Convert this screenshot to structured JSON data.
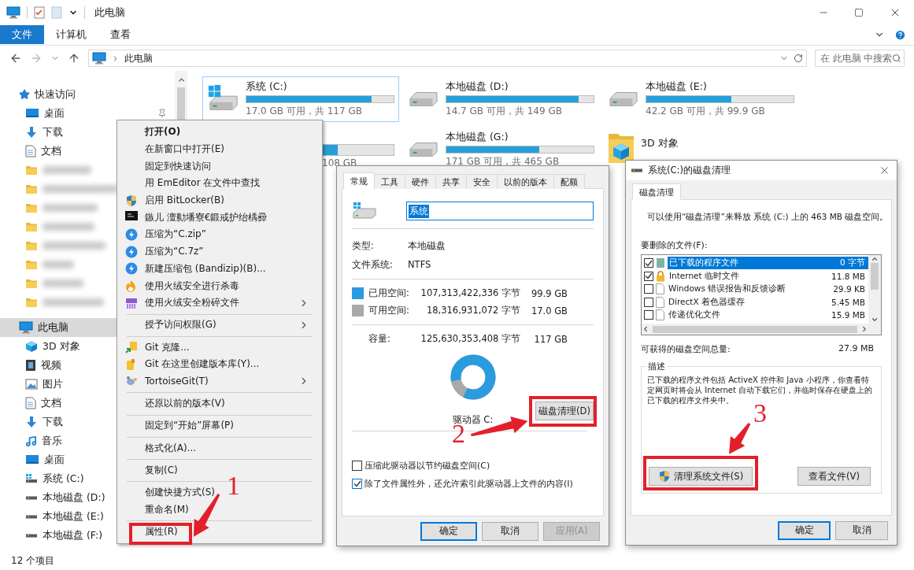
{
  "window": {
    "title": "此电脑"
  },
  "ribbon": {
    "tabs": [
      {
        "label": "文件",
        "selected": true
      },
      {
        "label": "计算机",
        "selected": false
      },
      {
        "label": "查看",
        "selected": false
      }
    ]
  },
  "address_bar": {
    "path": "此电脑"
  },
  "search": {
    "placeholder": "在 此电脑 中搜索"
  },
  "nav": {
    "items": [
      {
        "label": "快速访问",
        "kind": "star",
        "selected": false,
        "children": [
          {
            "label": "桌面",
            "kind": "desktop",
            "selected": false,
            "pinned": true
          },
          {
            "label": "下载",
            "kind": "download",
            "selected": false
          },
          {
            "label": "文档",
            "kind": "document",
            "selected": false
          },
          {
            "kind": "blurred",
            "selected": false
          },
          {
            "kind": "blurred",
            "selected": false
          },
          {
            "kind": "blurred",
            "selected": false
          },
          {
            "kind": "blurred",
            "selected": false
          },
          {
            "kind": "blurred",
            "selected": false
          },
          {
            "kind": "blurred",
            "selected": false
          },
          {
            "kind": "blurred",
            "selected": false
          },
          {
            "kind": "blurred",
            "selected": false
          }
        ]
      },
      {
        "label": "此电脑",
        "kind": "pc",
        "selected": true,
        "children": [
          {
            "label": "3D 对象",
            "kind": "cube",
            "selected": false
          },
          {
            "label": "视频",
            "kind": "video",
            "selected": false
          },
          {
            "label": "图片",
            "kind": "picture",
            "selected": false
          },
          {
            "label": "文档",
            "kind": "document",
            "selected": false
          },
          {
            "label": "下载",
            "kind": "download",
            "selected": false
          },
          {
            "label": "音乐",
            "kind": "music",
            "selected": false
          },
          {
            "label": "桌面",
            "kind": "desktop",
            "selected": false
          },
          {
            "label": "系统 (C:)",
            "kind": "system_drive",
            "selected": false
          },
          {
            "label": "本地磁盘 (D:)",
            "kind": "drive",
            "selected": false
          },
          {
            "label": "本地磁盘 (E:)",
            "kind": "drive",
            "selected": false
          },
          {
            "label": "本地磁盘 (F:)",
            "kind": "drive",
            "selected": false
          }
        ]
      }
    ]
  },
  "drives": [
    {
      "kind": "system",
      "name": "系统 (C:)",
      "info": "17.0 GB 可用，共 117 GB",
      "level": 0.85,
      "selected": true
    },
    {
      "kind": "drive",
      "name": "本地磁盘 (D:)",
      "info": "14.7 GB 可用，共 149 GB",
      "level": 0.9,
      "selected": false
    },
    {
      "kind": "drive",
      "name": "本地磁盘 (E:)",
      "info": "42.2 GB 可用，共 99.9 GB",
      "level": 0.58,
      "selected": false
    },
    {
      "kind": "partial",
      "info": "108 GB",
      "level": 0.62,
      "selected": false
    },
    {
      "kind": "drive",
      "name": "本地磁盘 (G:)",
      "info": "171 GB 可用，共 465 GB",
      "level": 0.63,
      "selected": false
    }
  ],
  "folders": [
    {
      "label": "3D 对象",
      "kind": "cube"
    }
  ],
  "status_bar": {
    "text": "12 个项目"
  },
  "context_menu": {
    "groups": [
      [
        {
          "label": "打开(O)",
          "kind": "plain",
          "default": true,
          "submenu": false
        },
        {
          "label": "在新窗口中打开(E)",
          "kind": "plain",
          "default": false,
          "submenu": false
        },
        {
          "label": "固定到快速访问",
          "kind": "plain",
          "default": false,
          "submenu": false
        },
        {
          "label": "用 EmEditor 在文件中查找",
          "kind": "plain",
          "default": false,
          "submenu": false
        },
        {
          "label": "启用 BitLocker(B)",
          "kind": "shield",
          "default": false,
          "submenu": false
        },
        {
          "label": "鏃儿   澶勬墦寮€鍛戒护绐楀彛",
          "kind": "terminal",
          "default": false,
          "submenu": false
        },
        {
          "label": "压缩为“C.zip”",
          "kind": "bandizip",
          "default": false,
          "submenu": false
        },
        {
          "label": "压缩为“C.7z”",
          "kind": "bandizip",
          "default": false,
          "submenu": false
        },
        {
          "label": "新建压缩包 (Bandizip)(B)...",
          "kind": "bandizip",
          "default": false,
          "submenu": false
        },
        {
          "label": "使用火绒安全进行杀毒",
          "kind": "flame",
          "default": false,
          "submenu": false
        },
        {
          "label": "使用火绒安全粉碎文件",
          "kind": "shredder",
          "default": false,
          "submenu": true
        }
      ],
      [
        {
          "label": "授予访问权限(G)",
          "kind": "plain",
          "default": false,
          "submenu": true
        }
      ],
      [
        {
          "label": "Git 克隆...",
          "kind": "git_clone",
          "default": false,
          "submenu": false
        },
        {
          "label": "Git 在这里创建版本库(Y)...",
          "kind": "git_repo",
          "default": false,
          "submenu": false
        },
        {
          "label": "TortoiseGit(T)",
          "kind": "tortoise",
          "default": false,
          "submenu": true
        }
      ],
      [
        {
          "label": "还原以前的版本(V)",
          "kind": "plain",
          "default": false,
          "submenu": false
        }
      ],
      [
        {
          "label": "固定到“开始”屏幕(P)",
          "kind": "plain",
          "default": false,
          "submenu": false
        }
      ],
      [
        {
          "label": "格式化(A)...",
          "kind": "plain",
          "default": false,
          "submenu": false
        }
      ],
      [
        {
          "label": "复制(C)",
          "kind": "plain",
          "default": false,
          "submenu": false
        }
      ],
      [
        {
          "label": "创建快捷方式(S)",
          "kind": "plain",
          "default": false,
          "submenu": false
        },
        {
          "label": "重命名(M)",
          "kind": "plain",
          "default": false,
          "submenu": false
        }
      ],
      [
        {
          "label": "属性(R)",
          "kind": "plain",
          "default": false,
          "submenu": false
        }
      ]
    ]
  },
  "properties": {
    "tabs": [
      {
        "label": "常规",
        "selected": true
      },
      {
        "label": "工具",
        "selected": false
      },
      {
        "label": "硬件",
        "selected": false
      },
      {
        "label": "共享",
        "selected": false
      },
      {
        "label": "安全",
        "selected": false
      },
      {
        "label": "以前的版本",
        "selected": false
      },
      {
        "label": "配额",
        "selected": false
      }
    ],
    "name_value": "系统",
    "rows": [
      {
        "label": "类型:",
        "value": "本地磁盘"
      },
      {
        "label": "文件系统:",
        "value": "NTFS"
      }
    ],
    "space": [
      {
        "label": "已用空间:",
        "bytes": "107,313,422,336 字节",
        "size": "99.9 GB",
        "color": "#2b9be0"
      },
      {
        "label": "可用空间:",
        "bytes": "18,316,931,072 字节",
        "size": "17.0 GB",
        "color": "#a9a9a9"
      }
    ],
    "capacity": {
      "label": "容量:",
      "bytes": "125,630,353,408 字节",
      "size": "117 GB"
    },
    "usage_ring": {
      "level": 0.85
    },
    "drive_label": "驱动器 C:",
    "cleanup_button": "磁盘清理(D)",
    "options": [
      {
        "label": "压缩此驱动器以节约磁盘空间(C)",
        "checked": false
      },
      {
        "label": "除了文件属性外，还允许索引此驱动器上文件的内容(I)",
        "checked": true
      }
    ],
    "buttons": [
      {
        "label": "确定",
        "kind": "default"
      },
      {
        "label": "取消",
        "kind": "normal"
      },
      {
        "label": "应用(A)",
        "kind": "disabled"
      }
    ]
  },
  "cleanup": {
    "title": "系统(C:)的磁盘清理",
    "tabs": [
      {
        "label": "磁盘清理",
        "selected": true
      }
    ],
    "intro": "可以使用“磁盘清理”来释放 系统 (C:) 上的 463 MB 磁盘空间。",
    "list_label": "要删除的文件(F):",
    "files": [
      {
        "label": "已下载的程序文件",
        "size": "0 字节",
        "kind": "package",
        "checked": true,
        "selected": true
      },
      {
        "label": "Internet 临时文件",
        "size": "11.8 MB",
        "kind": "lock",
        "checked": true,
        "selected": false
      },
      {
        "label": "Windows 错误报告和反馈诊断",
        "size": "29.9 KB",
        "kind": "file",
        "checked": false,
        "selected": false
      },
      {
        "label": "DirectX 着色器缓存",
        "size": "5.45 MB",
        "kind": "file",
        "checked": false,
        "selected": false
      },
      {
        "label": "传递优化文件",
        "size": "15.9 MB",
        "kind": "file",
        "checked": false,
        "selected": false
      }
    ],
    "total_label": "可获得的磁盘空间总量:",
    "total": "27.9 MB",
    "group_label": "描述",
    "description": "已下载的程序文件包括 ActiveX 控件和 Java 小程序，你查看特定网页时将会从 Internet 自动下载它们，并临时保存在硬盘上的已下载的程序文件夹中。",
    "action_buttons": [
      {
        "label": "清理系统文件(S)",
        "kind": "shield"
      },
      {
        "label": "查看文件(V)",
        "kind": "plain"
      }
    ],
    "buttons": [
      {
        "label": "确定",
        "kind": "default"
      },
      {
        "label": "取消",
        "kind": "normal"
      }
    ]
  },
  "annotations": [
    {
      "label": "1"
    },
    {
      "label": "2"
    },
    {
      "label": "3"
    }
  ]
}
